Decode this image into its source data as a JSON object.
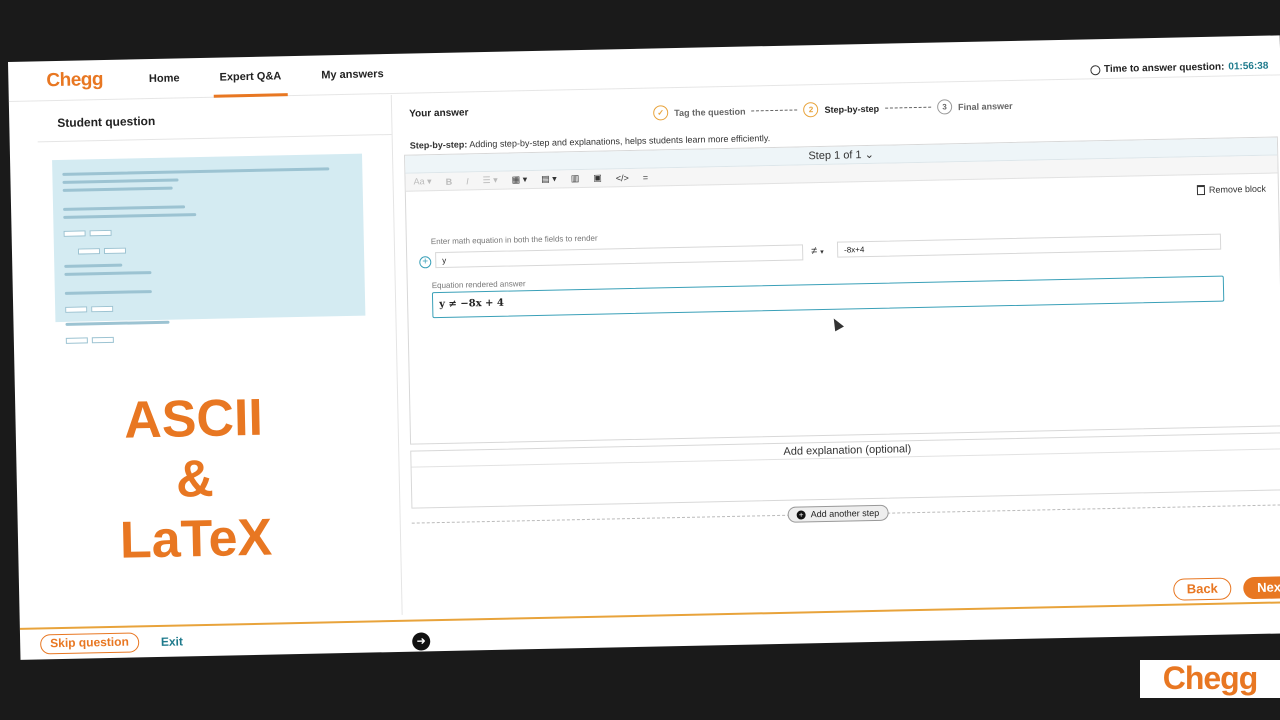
{
  "nav": {
    "logo": "Chegg",
    "links": [
      "Home",
      "Expert Q&A",
      "My answers"
    ],
    "active_index": 1
  },
  "timer": {
    "label": "Time to answer question:",
    "value": "01:56:38"
  },
  "left": {
    "title": "Student question",
    "overlay_text": [
      "ASCII",
      "&",
      "LaTeX"
    ]
  },
  "right": {
    "title": "Your answer",
    "stepper": [
      {
        "label": "Tag the question",
        "state": "done",
        "num": "✓"
      },
      {
        "label": "Step-by-step",
        "state": "current",
        "num": "2"
      },
      {
        "label": "Final answer",
        "state": "pending",
        "num": "3"
      }
    ],
    "info_bold": "Step-by-step:",
    "info_text": "Adding step-by-step and explanations, helps students learn more efficiently.",
    "step_header": "Step 1 of 1",
    "remove_block": "Remove block",
    "math_hint": "Enter math equation in both the fields to render",
    "field_left": "y",
    "relation": "≠",
    "field_right": "-8x+4",
    "rendered_label": "Equation rendered answer",
    "rendered_value": "y ≠ −8x + 4",
    "explanation": "Add explanation (optional)",
    "add_step": "Add another step",
    "back": "Back",
    "next": "Next"
  },
  "footer": {
    "skip": "Skip question",
    "exit": "Exit"
  },
  "watermark": "Chegg",
  "colors": {
    "brand": "#e87722",
    "accent": "#1e7a8c",
    "focus": "#3aa0b8"
  }
}
